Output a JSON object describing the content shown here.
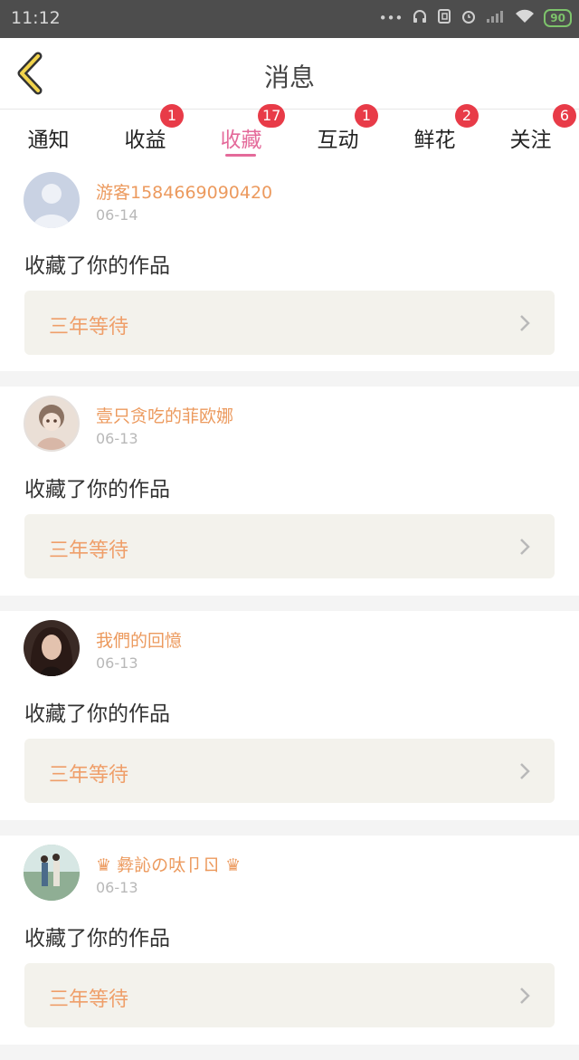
{
  "status_bar": {
    "time": "11:12",
    "dots": "•••",
    "battery": "90"
  },
  "header": {
    "title": "消息",
    "back_icon": "chevron-left-icon"
  },
  "tabs": [
    {
      "label": "通知",
      "badge": "",
      "active": false
    },
    {
      "label": "收益",
      "badge": "1",
      "active": false
    },
    {
      "label": "收藏",
      "badge": "17",
      "active": true
    },
    {
      "label": "互动",
      "badge": "1",
      "active": false
    },
    {
      "label": "鲜花",
      "badge": "2",
      "active": false
    },
    {
      "label": "关注",
      "badge": "6",
      "active": false
    }
  ],
  "colors": {
    "accent_pink": "#e46a9a",
    "badge_red": "#e83b48",
    "username_orange": "#ec9a5e",
    "work_title_orange": "#ef9f6a",
    "status_bar_bg": "#4d4d4d"
  },
  "messages": [
    {
      "username": "游客1584669090420",
      "date": "06-14",
      "text": "收藏了你的作品",
      "work_title": "三年等待"
    },
    {
      "username": "壹只贪吃的菲欧娜",
      "date": "06-13",
      "text": "收藏了你的作品",
      "work_title": "三年等待"
    },
    {
      "username": "我們的回憶",
      "date": "06-13",
      "text": "收藏了你的作品",
      "work_title": "三年等待"
    },
    {
      "username": "♛ 彜訫の呔卩ㄖ ♛",
      "date": "06-13",
      "text": "收藏了你的作品",
      "work_title": "三年等待"
    }
  ]
}
